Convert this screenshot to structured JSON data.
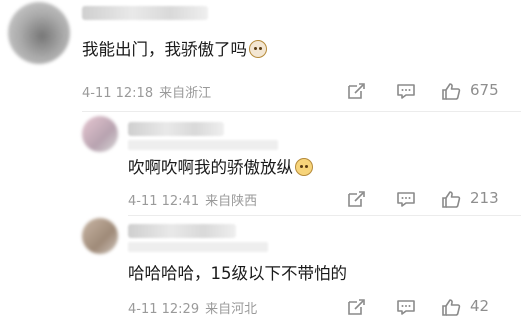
{
  "comments": [
    {
      "text": "我能出门，我骄傲了吗",
      "emoji": "cat-face-icon",
      "date": "4-11 12:18",
      "location": "来自浙江",
      "likes": "675"
    },
    {
      "text": "吹啊吹啊我的骄傲放纵",
      "emoji": "doge-face-icon",
      "date": "4-11 12:41",
      "location": "来自陕西",
      "likes": "213"
    },
    {
      "text": "哈哈哈哈，15级以下不带怕的",
      "emoji": "",
      "date": "4-11 12:29",
      "location": "来自河北",
      "likes": "42"
    }
  ],
  "colors": {
    "text": "#1a1a1a",
    "meta": "#9a9a9a",
    "icon": "#8a8a8a",
    "divider": "#ececec"
  }
}
